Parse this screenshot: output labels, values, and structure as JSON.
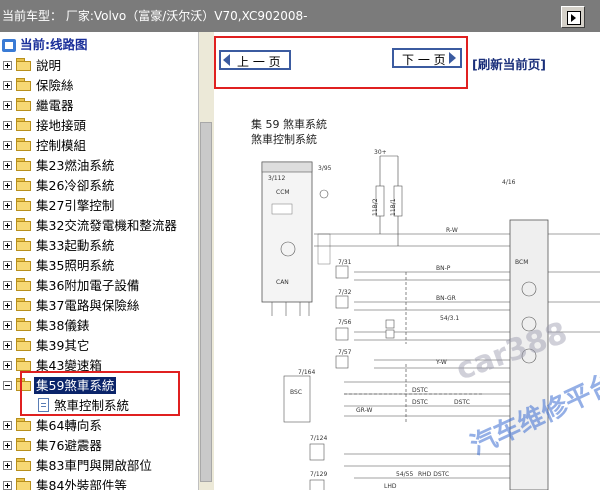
{
  "window": {
    "title": "当前车型： 厂家:Volvo（富豪/沃尔沃）V70,XC902008-",
    "top_button_icon": "play-arrow-icon"
  },
  "tree": {
    "root_label": "当前:线路图",
    "items": [
      {
        "label": "說明",
        "expanded": false
      },
      {
        "label": "保險絲",
        "expanded": false
      },
      {
        "label": "繼電器",
        "expanded": false
      },
      {
        "label": "接地接頭",
        "expanded": false
      },
      {
        "label": "控制模組",
        "expanded": false
      },
      {
        "label": "集23燃油系統",
        "expanded": false
      },
      {
        "label": "集26冷卻系統",
        "expanded": false
      },
      {
        "label": "集27引擎控制",
        "expanded": false
      },
      {
        "label": "集32交流發電機和整流器",
        "expanded": false
      },
      {
        "label": "集33起動系統",
        "expanded": false
      },
      {
        "label": "集35照明系統",
        "expanded": false
      },
      {
        "label": "集36附加電子設備",
        "expanded": false
      },
      {
        "label": "集37電路與保險絲",
        "expanded": false
      },
      {
        "label": "集38儀錶",
        "expanded": false
      },
      {
        "label": "集39其它",
        "expanded": false
      },
      {
        "label": "集43變速箱",
        "expanded": false
      },
      {
        "label": "集59煞車系統",
        "expanded": true,
        "selected": true
      },
      {
        "label": "煞車控制系統",
        "child": true
      },
      {
        "label": "集64轉向系",
        "expanded": false
      },
      {
        "label": "集76避震器",
        "expanded": false
      },
      {
        "label": "集83車門與開啟部位",
        "expanded": false
      },
      {
        "label": "集84外裝部件等",
        "expanded": false
      }
    ]
  },
  "nav": {
    "prev_label": "上 一 页",
    "next_label": "下 一 页",
    "refresh_label": "[刷新当前页]"
  },
  "diagram": {
    "title_line1": "集 59 煞車系統",
    "title_line2": "煞車控制系統",
    "labels": [
      "3/112",
      "3/95",
      "CCM",
      "30+",
      "11B/2",
      "11B/1",
      "4/16",
      "BCM",
      "7/31",
      "7/32",
      "7/56",
      "7/57",
      "7/164",
      "BSC",
      "7/124",
      "7/129",
      "54/3.1",
      "54/55",
      "RHD",
      "DSTC",
      "CAN",
      "R-W",
      "BN-P",
      "BN-GR",
      "GR-W",
      "Y-W",
      "LHD"
    ],
    "watermark_1": "car388",
    "watermark_2": "汽车维修平台"
  },
  "colors": {
    "selection": "#0a246a",
    "nav_button_border": "#3b5ba0",
    "refresh_text": "#1a2f7a",
    "highlight_box": "#e02020",
    "titlebar": "#7b7b7b"
  }
}
